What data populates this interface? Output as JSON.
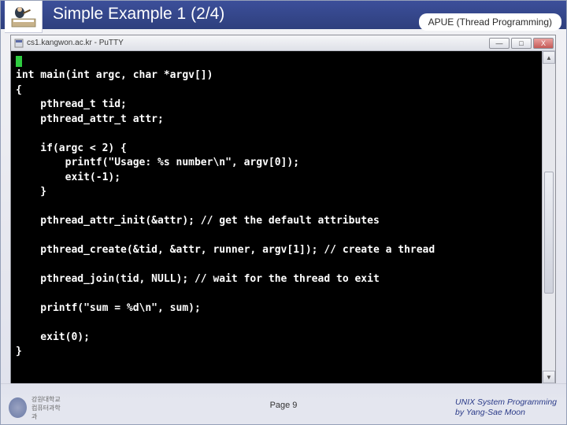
{
  "header": {
    "title": "Simple Example 1 (2/4)",
    "subtitle": "APUE (Thread Programming)"
  },
  "window": {
    "title": "cs1.kangwon.ac.kr - PuTTY",
    "buttons": {
      "min": "—",
      "max": "□",
      "close": "X"
    }
  },
  "code": {
    "lines": [
      "",
      "int main(int argc, char *argv[])",
      "{",
      "    pthread_t tid;",
      "    pthread_attr_t attr;",
      "",
      "    if(argc < 2) {",
      "        printf(\"Usage: %s number\\n\", argv[0]);",
      "        exit(-1);",
      "    }",
      "",
      "    pthread_attr_init(&attr); // get the default attributes",
      "",
      "    pthread_create(&tid, &attr, runner, argv[1]); // create a thread",
      "",
      "    pthread_join(tid, NULL); // wait for the thread to exit",
      "",
      "    printf(\"sum = %d\\n\", sum);",
      "",
      "    exit(0);",
      "}"
    ]
  },
  "footer": {
    "logo_text": "강원대학교\n컴퓨터과학과",
    "page": "Page 9",
    "credit_line1": "UNIX System Programming",
    "credit_line2": "by Yang-Sae Moon"
  }
}
